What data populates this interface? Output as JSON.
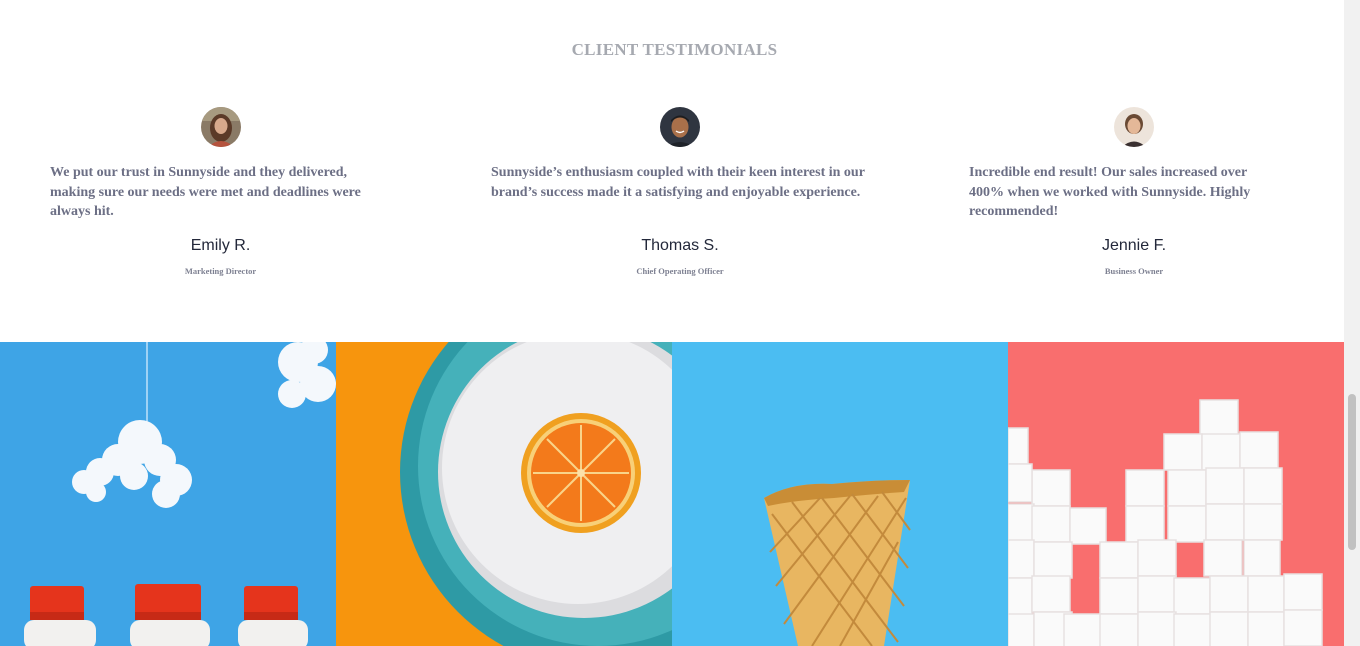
{
  "section": {
    "heading": "CLIENT TESTIMONIALS"
  },
  "testimonials": [
    {
      "quote": "We put our trust in Sunnyside and they delivered, making sure our needs were met and deadlines were always hit.",
      "name": "Emily R.",
      "role": "Marketing Director"
    },
    {
      "quote": "Sunnyside’s enthusiasm coupled with their keen interest in our brand’s success made it a satisfying and enjoyable experience.",
      "name": "Thomas S.",
      "role": "Chief Operating Officer"
    },
    {
      "quote": "Incredible end result! Our sales increased over 400% when we worked with Sunnyside. Highly recommended!",
      "name": "Jennie F.",
      "role": "Business Owner"
    }
  ],
  "gallery": {
    "images": [
      {
        "subject": "milk-bottles-and-cloud",
        "background": "#3ea4e6"
      },
      {
        "subject": "orange-on-plate",
        "background": "#f7950d"
      },
      {
        "subject": "ice-cream-cone",
        "background": "#4bbdf2"
      },
      {
        "subject": "sugar-cubes",
        "background": "#f96e6e"
      }
    ]
  }
}
